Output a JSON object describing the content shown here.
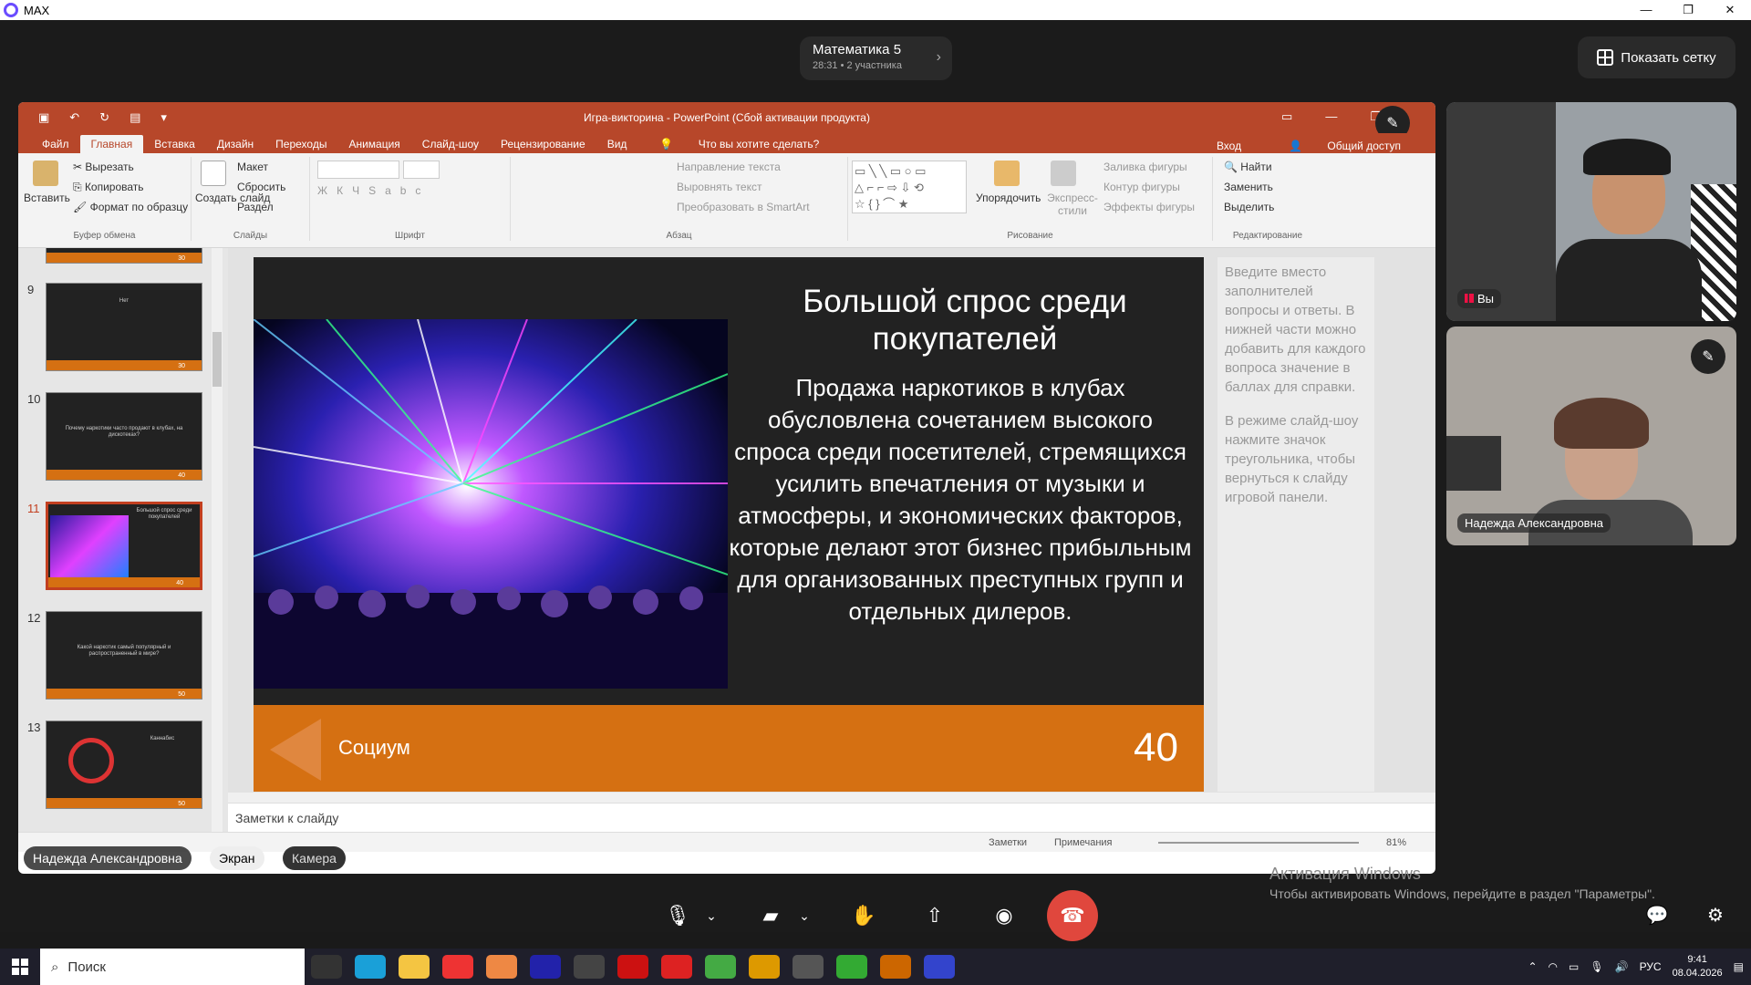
{
  "app": {
    "title": "MAX"
  },
  "window_controls": {
    "minimize": "—",
    "maximize": "❐",
    "close": "✕"
  },
  "call": {
    "title": "Математика 5",
    "meta": "28:31 • 2 участника",
    "grid_button": "Показать сетку"
  },
  "ppt": {
    "doc_title": "Игра-викторина - PowerPoint (Сбой активации продукта)",
    "tabs": [
      "Файл",
      "Главная",
      "Вставка",
      "Дизайн",
      "Переходы",
      "Анимация",
      "Слайд-шоу",
      "Рецензирование",
      "Вид"
    ],
    "active_tab": "Главная",
    "tell_me": "Что вы хотите сделать?",
    "signin": "Вход",
    "share": "Общий доступ",
    "ribbon": {
      "paste": "Вставить",
      "cut": "Вырезать",
      "copy": "Копировать",
      "format_painter": "Формат по образцу",
      "clipboard": "Буфер обмена",
      "new_slide": "Создать слайд",
      "layout": "Макет",
      "reset": "Сбросить",
      "section": "Раздел",
      "slides": "Слайды",
      "font": "Шрифт",
      "text_direction": "Направление текста",
      "align_text": "Выровнять текст",
      "smartart": "Преобразовать в SmartArt",
      "paragraph": "Абзац",
      "arrange": "Упорядочить",
      "quick_styles": "Экспресс-стили",
      "shape_fill": "Заливка фигуры",
      "shape_outline": "Контур фигуры",
      "shape_effects": "Эффекты фигуры",
      "drawing": "Рисование",
      "find": "Найти",
      "replace": "Заменить",
      "select": "Выделить",
      "editing": "Редактирование"
    },
    "thumbs": [
      {
        "num": "9",
        "text": "Нет",
        "points": "30"
      },
      {
        "num": "10",
        "text": "Почему наркотики часто продают в клубах, на дискотеках?",
        "points": "40"
      },
      {
        "num": "11",
        "text": "Большой спрос среди покупателей",
        "points": "40"
      },
      {
        "num": "12",
        "text": "Какой наркотик самый популярный и распространенный в мире?",
        "points": "50"
      },
      {
        "num": "13",
        "text": "Каннабис",
        "points": "50"
      }
    ],
    "top_thumb_points": "30",
    "slide": {
      "title": "Большой спрос среди покупателей",
      "body": "Продажа наркотиков в клубах обусловлена сочетанием высокого спроса среди посетителей, стремящихся усилить впечатления от музыки и атмосферы, и экономических факторов, которые делают этот бизнес прибыльным для организованных преступных групп и отдельных дилеров.",
      "category": "Социум",
      "points": "40"
    },
    "notes_pane": [
      "Введите вместо заполнителей вопросы и ответы. В нижней части можно добавить для каждого вопроса значение в баллах для справки.",
      "В режиме слайд-шоу нажмите значок треугольника, чтобы вернуться к слайду игровой панели."
    ],
    "notes_placeholder": "Заметки к слайду",
    "status": {
      "notes": "Заметки",
      "comments": "Примечания",
      "zoom": "81%"
    }
  },
  "overlay": {
    "presenter": "Надежда Александровна",
    "screen_chip": "Экран",
    "camera_chip": "Камера"
  },
  "participants": [
    {
      "name": "Вы"
    },
    {
      "name": "Надежда Александровна"
    }
  ],
  "activation": {
    "title": "Активация Windows",
    "text": "Чтобы активировать Windows, перейдите в раздел \"Параметры\"."
  },
  "taskbar": {
    "search": "Поиск",
    "lang": "РУС",
    "time": "9:41",
    "date": "08.04.2026"
  },
  "colors": {
    "ppt_accent": "#b7472a",
    "slide_orange": "#d57012",
    "end_call": "#e0473d"
  }
}
